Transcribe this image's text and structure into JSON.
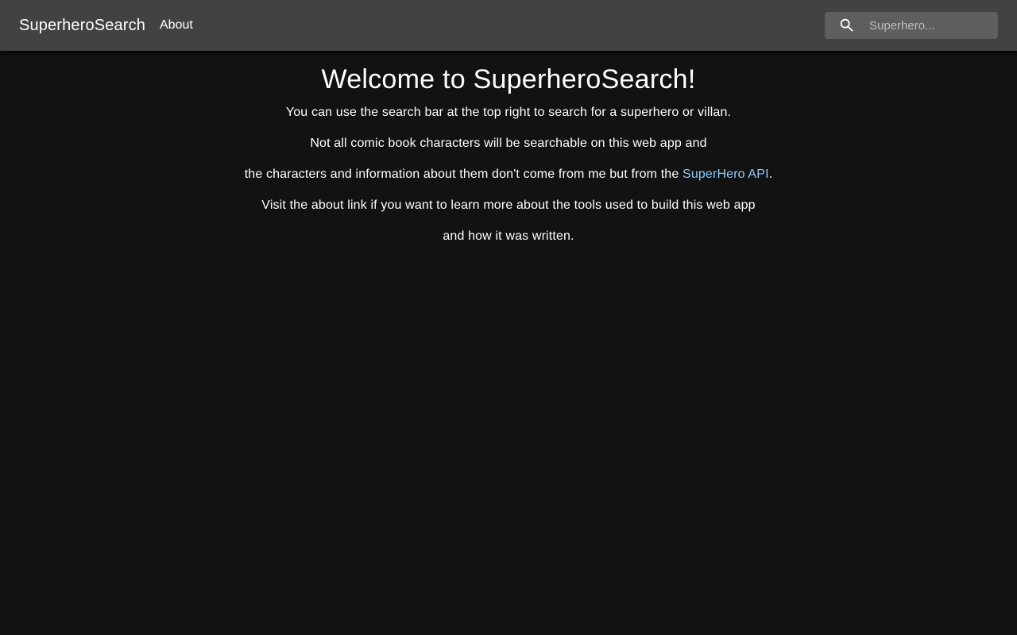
{
  "header": {
    "brand": "SuperheroSearch",
    "nav_about": "About",
    "search": {
      "icon": "search-icon",
      "placeholder": "Superhero..."
    }
  },
  "main": {
    "title": "Welcome to SuperheroSearch!",
    "line1": "You can use the search bar at the top right to search for a superhero or villan.",
    "line2": "Not all comic book characters will be searchable on this web app and",
    "line3_prefix": "the characters and information about them don't come from me but from the ",
    "line3_link": "SuperHero API",
    "line3_suffix": ".",
    "line4": "Visit the about link if you want to learn more about the tools used to build this web app",
    "line5": "and how it was written."
  },
  "colors": {
    "background": "#121212",
    "appbar": "#424242",
    "search_bg": "#5e5e5e",
    "link": "#90caf9"
  }
}
